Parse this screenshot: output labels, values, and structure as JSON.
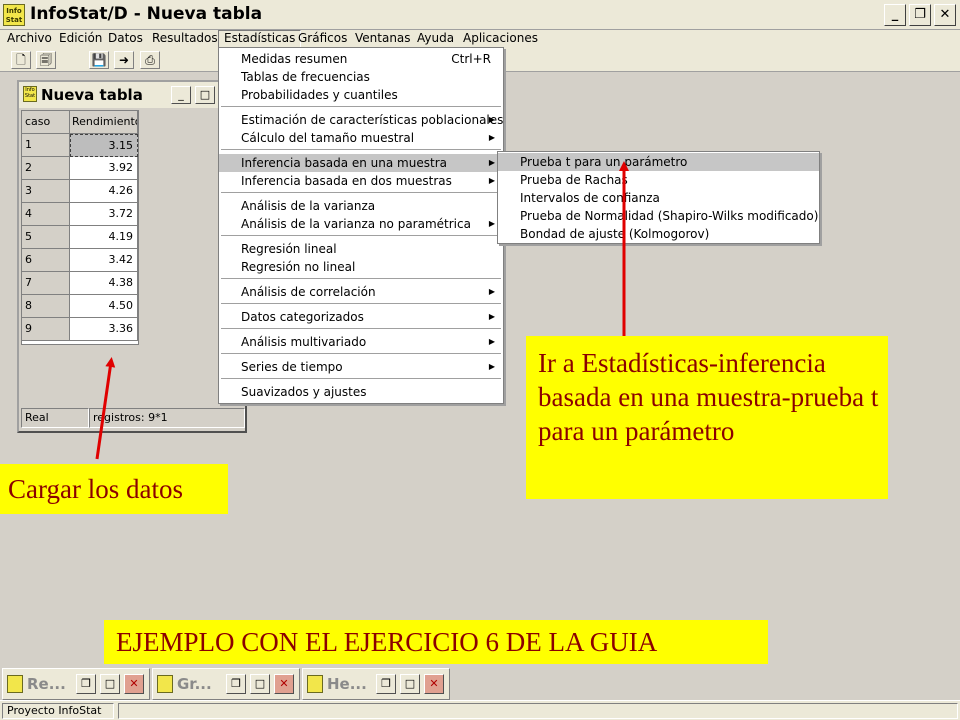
{
  "app": {
    "title": "InfoStat/D - Nueva tabla",
    "icon_text": "Info Stat"
  },
  "window_buttons": {
    "minimize": "_",
    "restore": "❐",
    "close": "✕"
  },
  "menu": [
    "Archivo",
    "Edición",
    "Datos",
    "Resultados",
    "Estadísticas",
    "Gráficos",
    "Ventanas",
    "Ayuda",
    "Aplicaciones"
  ],
  "active_menu": "Estadísticas",
  "toolbar_icons": [
    "new-file-icon",
    "open-file-icon",
    "save-icon",
    "export-icon",
    "print-icon"
  ],
  "subwindow": {
    "title": "Nueva tabla",
    "columns": [
      "caso",
      "Rendimiento"
    ],
    "rows": [
      {
        "caso": "1",
        "valor": "3.15"
      },
      {
        "caso": "2",
        "valor": "3.92"
      },
      {
        "caso": "3",
        "valor": "4.26"
      },
      {
        "caso": "4",
        "valor": "3.72"
      },
      {
        "caso": "5",
        "valor": "4.19"
      },
      {
        "caso": "6",
        "valor": "3.42"
      },
      {
        "caso": "7",
        "valor": "4.38"
      },
      {
        "caso": "8",
        "valor": "4.50"
      },
      {
        "caso": "9",
        "valor": "3.36"
      }
    ],
    "status_type": "Real",
    "status_records": "registros: 9*1"
  },
  "dropdown": {
    "items": [
      {
        "label": "Medidas resumen",
        "shortcut": "Ctrl+R"
      },
      {
        "label": "Tablas de frecuencias"
      },
      {
        "label": "Probabilidades y cuantiles"
      },
      {
        "label": "Estimación de características poblacionales",
        "submenu": true
      },
      {
        "label": "Cálculo del tamaño muestral",
        "submenu": true
      },
      {
        "label": "Inferencia basada en una muestra",
        "submenu": true,
        "highlighted": true
      },
      {
        "label": "Inferencia basada en dos muestras",
        "submenu": true
      },
      {
        "label": "Análisis de la varianza"
      },
      {
        "label": "Análisis de la varianza no paramétrica",
        "submenu": true
      },
      {
        "label": "Regresión lineal"
      },
      {
        "label": "Regresión no lineal"
      },
      {
        "label": "Análisis de correlación",
        "submenu": true
      },
      {
        "label": "Datos categorizados",
        "submenu": true
      },
      {
        "label": "Análisis multivariado",
        "submenu": true
      },
      {
        "label": "Series de tiempo",
        "submenu": true
      },
      {
        "label": "Suavizados y ajustes"
      }
    ]
  },
  "submenu": {
    "items": [
      {
        "label": "Prueba t para un parámetro",
        "highlighted": true
      },
      {
        "label": "Prueba de Rachas"
      },
      {
        "label": "Intervalos de confianza"
      },
      {
        "label": "Prueba de Normalidad (Shapiro-Wilks modificado)"
      },
      {
        "label": "Bondad de ajuste (Kolmogorov)"
      }
    ]
  },
  "annotations": {
    "note1": "Ir a Estadísticas-inferencia basada en una muestra-prueba t para un parámetro",
    "note2": "Cargar los datos",
    "note3": "EJEMPLO CON EL EJERCICIO 6 DE LA GUIA",
    "arrow_color": "#e00000",
    "highlight_color": "#ffff00"
  },
  "taskbar_windows": [
    {
      "label": "Re..."
    },
    {
      "label": "Gr..."
    },
    {
      "label": "He..."
    }
  ],
  "bottom_status": "Proyecto InfoStat"
}
